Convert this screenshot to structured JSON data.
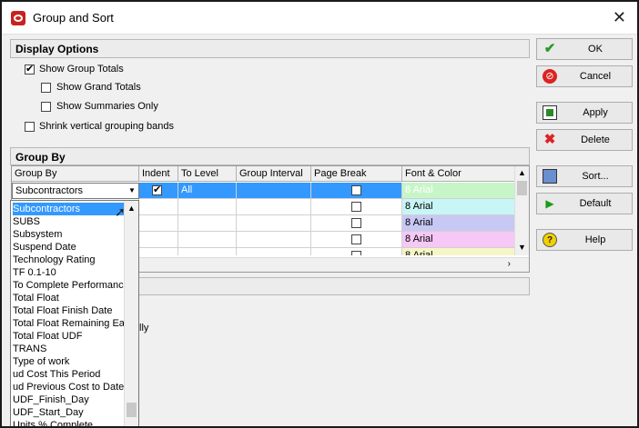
{
  "window": {
    "title": "Group and Sort",
    "close_glyph": "✕"
  },
  "display_options": {
    "header": "Display Options",
    "show_group_totals": "Show Group Totals",
    "show_grand_totals": "Show Grand Totals",
    "show_summaries_only": "Show Summaries Only",
    "shrink_bands": "Shrink vertical grouping bands"
  },
  "group_by": {
    "header": "Group By",
    "columns": [
      "Group By",
      "Indent",
      "To Level",
      "Group Interval",
      "Page Break",
      "Font & Color"
    ],
    "combo_value": "Subcontractors",
    "row1_level": "All",
    "fonts": [
      "8 Arial",
      "8 Arial",
      "8 Arial",
      "8 Arial",
      "8 Arial"
    ],
    "font_colors": [
      "#c8f5c8",
      "#c8f5f5",
      "#c8c8f5",
      "#f5c8f5",
      "#f5f5c8"
    ]
  },
  "dropdown_items": [
    "Subcontractors",
    "SUBS",
    "Subsystem",
    "Suspend Date",
    "Technology Rating",
    "TF 0.1-10",
    "To Complete Performance",
    "Total Float",
    "Total Float Finish Date",
    "Total Float Remaining Ear",
    "Total Float UDF",
    "TRANS",
    "Type of work",
    "ud Cost This Period",
    "ud Previous Cost to Date",
    "UDF_Finish_Day",
    "UDF_Start_Day",
    "Units % Complete"
  ],
  "partial_text": "lly",
  "buttons": {
    "ok": "OK",
    "cancel": "Cancel",
    "apply": "Apply",
    "delete": "Delete",
    "sort": "Sort...",
    "default": "Default",
    "help": "Help"
  },
  "colors": {
    "selection": "#3399ff"
  }
}
